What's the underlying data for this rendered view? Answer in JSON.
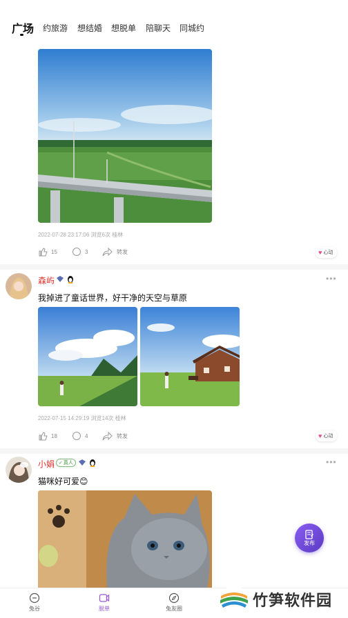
{
  "tabs": {
    "items": [
      "广场",
      "约旅游",
      "想结婚",
      "想脱单",
      "陪聊天",
      "同城约"
    ],
    "active": 0
  },
  "posts": [
    {
      "meta": "2022-07-28 23:17:06 浏览6次 桂林",
      "likes": "15",
      "comments": "3",
      "share": "转发",
      "heart": "心动"
    },
    {
      "username": "森屿",
      "caption": "我掉进了童话世界，好干净的天空与草原",
      "meta": "2022-07-15 14:29:19 浏览14次 桂林",
      "likes": "18",
      "comments": "4",
      "share": "转发",
      "heart": "心动"
    },
    {
      "username": "小娟",
      "realname": "真人",
      "caption": "猫咪好可爱😊"
    }
  ],
  "fab": {
    "label": "发布"
  },
  "bottom_nav": [
    {
      "label": "兔谷",
      "icon": "home-icon"
    },
    {
      "label": "脱单",
      "icon": "video-icon"
    },
    {
      "label": "兔友圈",
      "icon": "compass-icon"
    }
  ],
  "watermark": "竹笋软件园",
  "colors": {
    "accent": "#9b59d6",
    "username": "#e0342e",
    "heart": "#e8478b"
  }
}
